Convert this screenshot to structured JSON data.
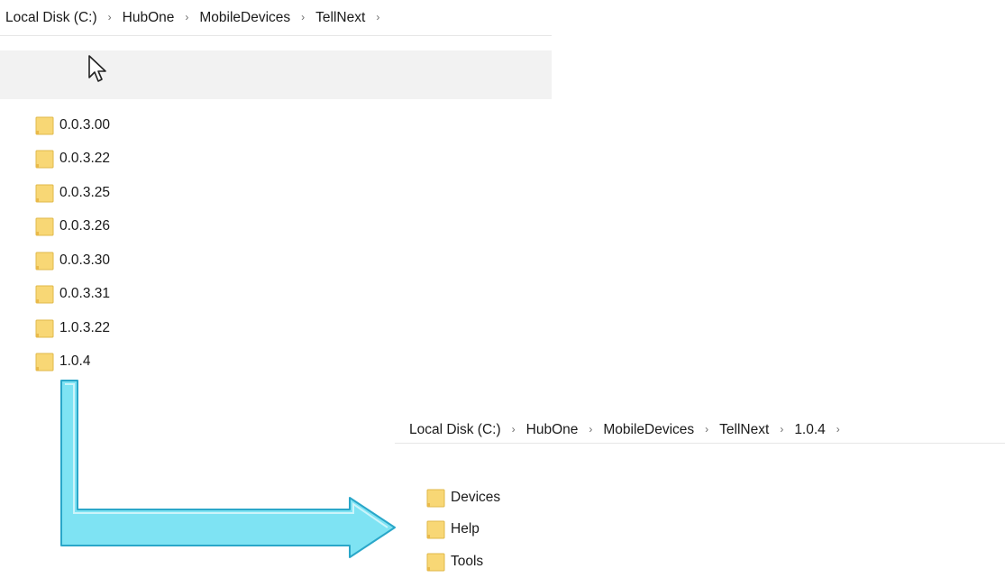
{
  "top_explorer": {
    "breadcrumb": [
      "Local Disk (C:)",
      "HubOne",
      "MobileDevices",
      "TellNext"
    ],
    "folders": [
      "0.0.3.00",
      "0.0.3.22",
      "0.0.3.25",
      "0.0.3.26",
      "0.0.3.30",
      "0.0.3.31",
      "1.0.3.22",
      "1.0.4"
    ]
  },
  "bottom_explorer": {
    "breadcrumb": [
      "Local Disk (C:)",
      "HubOne",
      "MobileDevices",
      "TellNext",
      "1.0.4"
    ],
    "folders": [
      "Devices",
      "Help",
      "Tools"
    ]
  },
  "separator_glyph": "›",
  "colors": {
    "folder_body": "#f8d775",
    "folder_edge": "#e0b84a",
    "arrow_fill": "#7ee3f3",
    "arrow_stroke": "#2aa7c9"
  }
}
